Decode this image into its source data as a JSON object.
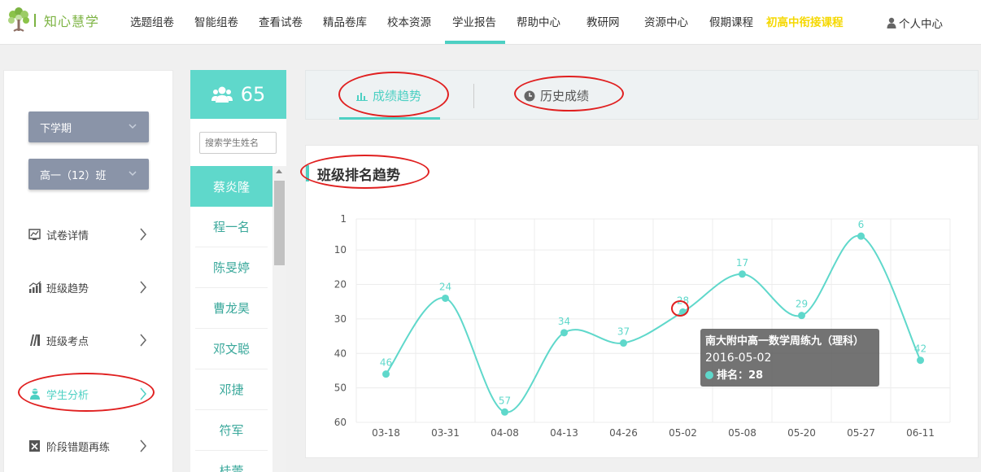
{
  "brand": {
    "name": "知心慧学"
  },
  "nav": {
    "items": [
      {
        "label": "选题组卷"
      },
      {
        "label": "智能组卷"
      },
      {
        "label": "查看试卷"
      },
      {
        "label": "精品卷库"
      },
      {
        "label": "校本资源"
      },
      {
        "label": "学业报告"
      },
      {
        "label": "帮助中心"
      },
      {
        "label": "教研网"
      },
      {
        "label": "资源中心"
      },
      {
        "label": "假期课程"
      },
      {
        "label": "初高中衔接课程"
      }
    ],
    "active_index": 5,
    "user_label": "个人中心",
    "highlight_color": "#f5d800",
    "accent_color": "#4dd0c3"
  },
  "sidebar": {
    "term_select": "下学期",
    "class_select": "高一（12）班",
    "menu": [
      {
        "label": "试卷详情",
        "icon": "exam-icon"
      },
      {
        "label": "班级趋势",
        "icon": "trend-icon"
      },
      {
        "label": "班级考点",
        "icon": "knowledge-icon"
      },
      {
        "label": "学生分析",
        "icon": "student-icon"
      },
      {
        "label": "阶段错题再练",
        "icon": "mistake-icon"
      }
    ],
    "active_menu_index": 3
  },
  "students": {
    "count": "65",
    "search_placeholder": "搜索学生姓名",
    "list": [
      "蔡炎隆",
      "程一名",
      "陈旻婷",
      "曹龙昊",
      "邓文聪",
      "邓捷",
      "符军",
      "桂蕾"
    ],
    "selected_index": 0
  },
  "tabs": {
    "trend_label": "成绩趋势",
    "history_label": "历史成绩",
    "active": "trend"
  },
  "panel": {
    "title": "班级排名趋势"
  },
  "chart_data": {
    "type": "line",
    "title": "班级排名趋势",
    "categories": [
      "03-18",
      "03-31",
      "04-08",
      "04-13",
      "04-26",
      "05-02",
      "05-08",
      "05-20",
      "05-27",
      "06-11"
    ],
    "series": [
      {
        "values": [
          46,
          24,
          57,
          34,
          37,
          28,
          17,
          29,
          6,
          42
        ]
      }
    ],
    "y_ticks": [
      1,
      10,
      20,
      30,
      40,
      50,
      60
    ],
    "ylim": [
      1,
      60
    ],
    "y_inverted": true,
    "grid": true,
    "line_color": "#5fd8cb",
    "smooth": true
  },
  "tooltip": {
    "title": "南大附中高一数学周练九（理科）",
    "date": "2016-05-02",
    "rank_label": "排名：28",
    "point_index": 5
  },
  "annotation_color": "#e02020"
}
